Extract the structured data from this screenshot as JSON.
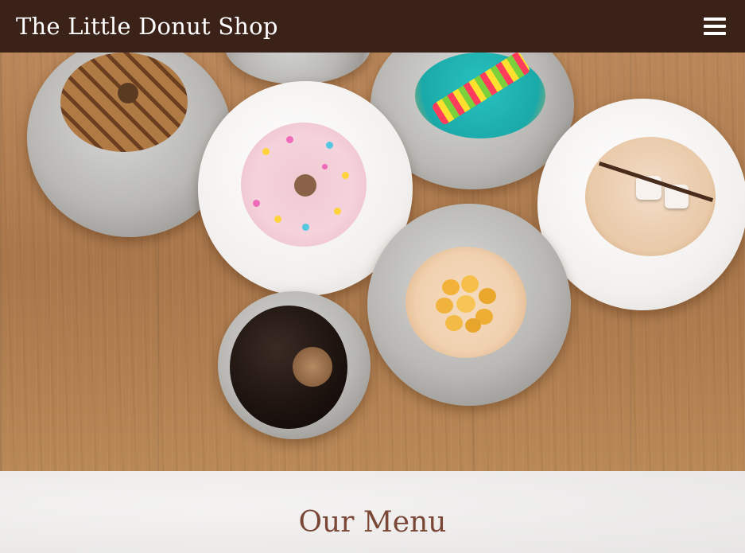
{
  "header": {
    "title": "The Little Donut Shop",
    "menu_icon": "hamburger-menu-icon"
  },
  "main": {
    "section_title": "Our Menu"
  },
  "colors": {
    "header_bg": "#3a2219",
    "title_text": "#ffffff",
    "section_title": "#7a4636"
  }
}
